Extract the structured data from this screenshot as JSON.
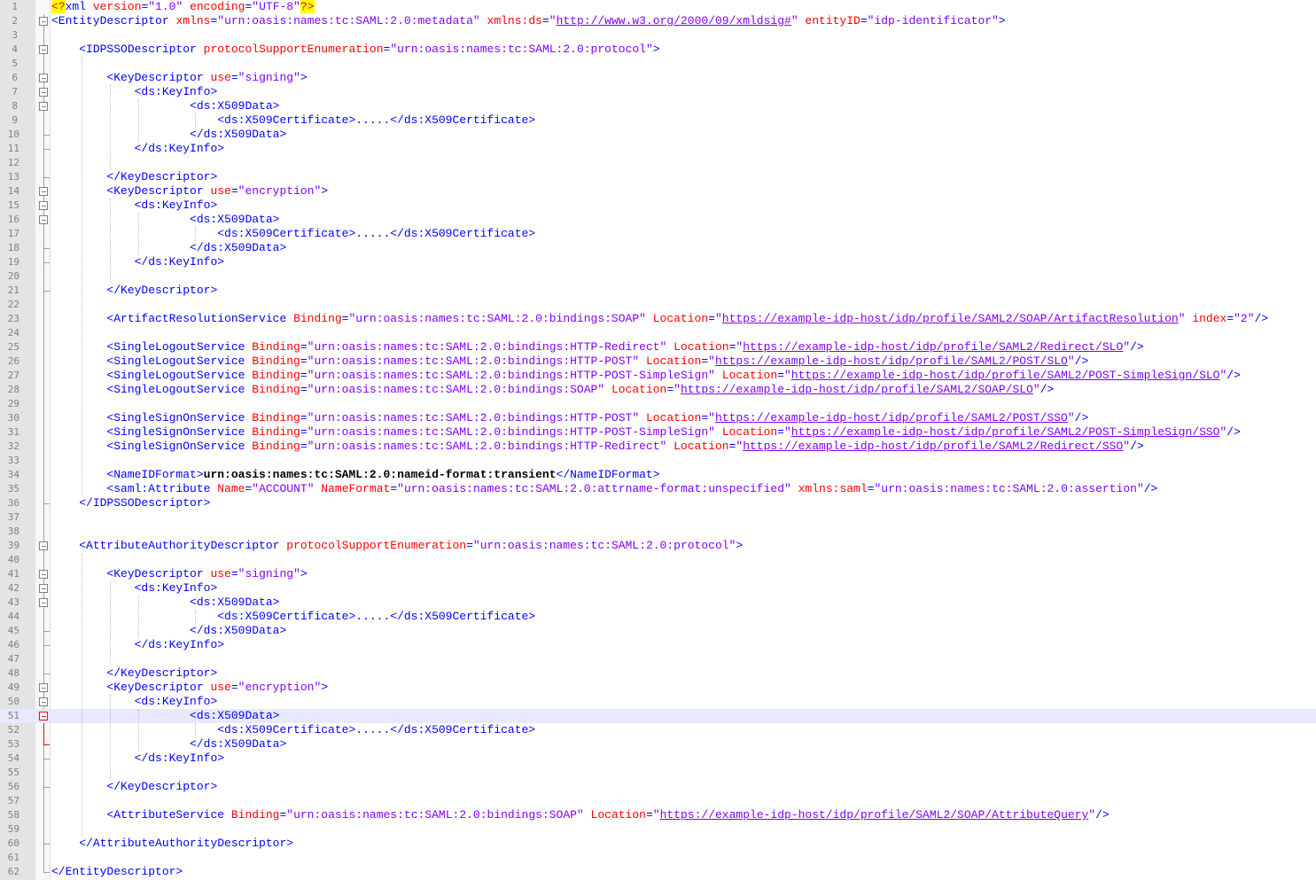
{
  "editor": {
    "current_line": 51,
    "lines": [
      {
        "n": "1",
        "i": 0,
        "tokens": [
          [
            "pi",
            "<?"
          ],
          [
            "t",
            "xml "
          ],
          [
            "a",
            "version"
          ],
          [
            "t",
            "="
          ],
          [
            "v",
            "\"1.0\""
          ],
          [
            "a",
            " encoding"
          ],
          [
            "t",
            "="
          ],
          [
            "v",
            "\"UTF-8\""
          ],
          [
            "pi",
            "?>"
          ]
        ]
      },
      {
        "n": "2",
        "i": 0,
        "tokens": [
          [
            "t",
            "<EntityDescriptor "
          ],
          [
            "a",
            "xmlns"
          ],
          [
            "t",
            "="
          ],
          [
            "v",
            "\"urn:oasis:names:tc:SAML:2.0:metadata\""
          ],
          [
            "a",
            " xmlns:ds"
          ],
          [
            "t",
            "="
          ],
          [
            "v",
            "\""
          ],
          [
            "u",
            "http://www.w3.org/2000/09/xmldsig#"
          ],
          [
            "v",
            "\""
          ],
          [
            "a",
            " entityID"
          ],
          [
            "t",
            "="
          ],
          [
            "v",
            "\"idp-identificator\""
          ],
          [
            "t",
            ">"
          ]
        ]
      },
      {
        "n": "3",
        "i": 0,
        "tokens": []
      },
      {
        "n": "4",
        "i": 4,
        "tokens": [
          [
            "t",
            "<IDPSSODescriptor "
          ],
          [
            "a",
            "protocolSupportEnumeration"
          ],
          [
            "t",
            "="
          ],
          [
            "v",
            "\"urn:oasis:names:tc:SAML:2.0:protocol\""
          ],
          [
            "t",
            ">"
          ]
        ]
      },
      {
        "n": "5",
        "i": 0,
        "tokens": []
      },
      {
        "n": "6",
        "i": 8,
        "tokens": [
          [
            "t",
            "<KeyDescriptor "
          ],
          [
            "a",
            "use"
          ],
          [
            "t",
            "="
          ],
          [
            "v",
            "\"signing\""
          ],
          [
            "t",
            ">"
          ]
        ]
      },
      {
        "n": "7",
        "i": 12,
        "tokens": [
          [
            "t",
            "<ds:KeyInfo>"
          ]
        ]
      },
      {
        "n": "8",
        "i": 20,
        "tokens": [
          [
            "t",
            "<ds:X509Data>"
          ]
        ]
      },
      {
        "n": "9",
        "i": 24,
        "tokens": [
          [
            "t",
            "<ds:X509Certificate>.....</ds:X509Certificate>"
          ]
        ]
      },
      {
        "n": "10",
        "i": 20,
        "tokens": [
          [
            "t",
            "</ds:X509Data>"
          ]
        ]
      },
      {
        "n": "11",
        "i": 12,
        "tokens": [
          [
            "t",
            "</ds:KeyInfo>"
          ]
        ]
      },
      {
        "n": "12",
        "i": 0,
        "tokens": []
      },
      {
        "n": "13",
        "i": 8,
        "tokens": [
          [
            "t",
            "</KeyDescriptor>"
          ]
        ]
      },
      {
        "n": "14",
        "i": 8,
        "tokens": [
          [
            "t",
            "<KeyDescriptor "
          ],
          [
            "a",
            "use"
          ],
          [
            "t",
            "="
          ],
          [
            "v",
            "\"encryption\""
          ],
          [
            "t",
            ">"
          ]
        ]
      },
      {
        "n": "15",
        "i": 12,
        "tokens": [
          [
            "t",
            "<ds:KeyInfo>"
          ]
        ]
      },
      {
        "n": "16",
        "i": 20,
        "tokens": [
          [
            "t",
            "<ds:X509Data>"
          ]
        ]
      },
      {
        "n": "17",
        "i": 24,
        "tokens": [
          [
            "t",
            "<ds:X509Certificate>.....</ds:X509Certificate>"
          ]
        ]
      },
      {
        "n": "18",
        "i": 20,
        "tokens": [
          [
            "t",
            "</ds:X509Data>"
          ]
        ]
      },
      {
        "n": "19",
        "i": 12,
        "tokens": [
          [
            "t",
            "</ds:KeyInfo>"
          ]
        ]
      },
      {
        "n": "20",
        "i": 0,
        "tokens": []
      },
      {
        "n": "21",
        "i": 8,
        "tokens": [
          [
            "t",
            "</KeyDescriptor>"
          ]
        ]
      },
      {
        "n": "22",
        "i": 0,
        "tokens": []
      },
      {
        "n": "23",
        "i": 8,
        "tokens": [
          [
            "t",
            "<ArtifactResolutionService "
          ],
          [
            "a",
            "Binding"
          ],
          [
            "t",
            "="
          ],
          [
            "v",
            "\"urn:oasis:names:tc:SAML:2.0:bindings:SOAP\""
          ],
          [
            "a",
            " Location"
          ],
          [
            "t",
            "="
          ],
          [
            "v",
            "\""
          ],
          [
            "u",
            "https://example-idp-host/idp/profile/SAML2/SOAP/ArtifactResolution"
          ],
          [
            "v",
            "\""
          ],
          [
            "a",
            " index"
          ],
          [
            "t",
            "="
          ],
          [
            "v",
            "\"2\""
          ],
          [
            "t",
            "/>"
          ]
        ]
      },
      {
        "n": "24",
        "i": 0,
        "tokens": []
      },
      {
        "n": "25",
        "i": 8,
        "tokens": [
          [
            "t",
            "<SingleLogoutService "
          ],
          [
            "a",
            "Binding"
          ],
          [
            "t",
            "="
          ],
          [
            "v",
            "\"urn:oasis:names:tc:SAML:2.0:bindings:HTTP-Redirect\""
          ],
          [
            "a",
            " Location"
          ],
          [
            "t",
            "="
          ],
          [
            "v",
            "\""
          ],
          [
            "u",
            "https://example-idp-host/idp/profile/SAML2/Redirect/SLO"
          ],
          [
            "v",
            "\""
          ],
          [
            "t",
            "/>"
          ]
        ]
      },
      {
        "n": "26",
        "i": 8,
        "tokens": [
          [
            "t",
            "<SingleLogoutService "
          ],
          [
            "a",
            "Binding"
          ],
          [
            "t",
            "="
          ],
          [
            "v",
            "\"urn:oasis:names:tc:SAML:2.0:bindings:HTTP-POST\""
          ],
          [
            "a",
            " Location"
          ],
          [
            "t",
            "="
          ],
          [
            "v",
            "\""
          ],
          [
            "u",
            "https://example-idp-host/idp/profile/SAML2/POST/SLO"
          ],
          [
            "v",
            "\""
          ],
          [
            "t",
            "/>"
          ]
        ]
      },
      {
        "n": "27",
        "i": 8,
        "tokens": [
          [
            "t",
            "<SingleLogoutService "
          ],
          [
            "a",
            "Binding"
          ],
          [
            "t",
            "="
          ],
          [
            "v",
            "\"urn:oasis:names:tc:SAML:2.0:bindings:HTTP-POST-SimpleSign\""
          ],
          [
            "a",
            " Location"
          ],
          [
            "t",
            "="
          ],
          [
            "v",
            "\""
          ],
          [
            "u",
            "https://example-idp-host/idp/profile/SAML2/POST-SimpleSign/SLO"
          ],
          [
            "v",
            "\""
          ],
          [
            "t",
            "/>"
          ]
        ]
      },
      {
        "n": "28",
        "i": 8,
        "tokens": [
          [
            "t",
            "<SingleLogoutService "
          ],
          [
            "a",
            "Binding"
          ],
          [
            "t",
            "="
          ],
          [
            "v",
            "\"urn:oasis:names:tc:SAML:2.0:bindings:SOAP\""
          ],
          [
            "a",
            " Location"
          ],
          [
            "t",
            "="
          ],
          [
            "v",
            "\""
          ],
          [
            "u",
            "https://example-idp-host/idp/profile/SAML2/SOAP/SLO"
          ],
          [
            "v",
            "\""
          ],
          [
            "t",
            "/>"
          ]
        ]
      },
      {
        "n": "29",
        "i": 0,
        "tokens": []
      },
      {
        "n": "30",
        "i": 8,
        "tokens": [
          [
            "t",
            "<SingleSignOnService "
          ],
          [
            "a",
            "Binding"
          ],
          [
            "t",
            "="
          ],
          [
            "v",
            "\"urn:oasis:names:tc:SAML:2.0:bindings:HTTP-POST\""
          ],
          [
            "a",
            " Location"
          ],
          [
            "t",
            "="
          ],
          [
            "v",
            "\""
          ],
          [
            "u",
            "https://example-idp-host/idp/profile/SAML2/POST/SSO"
          ],
          [
            "v",
            "\""
          ],
          [
            "t",
            "/>"
          ]
        ]
      },
      {
        "n": "31",
        "i": 8,
        "tokens": [
          [
            "t",
            "<SingleSignOnService "
          ],
          [
            "a",
            "Binding"
          ],
          [
            "t",
            "="
          ],
          [
            "v",
            "\"urn:oasis:names:tc:SAML:2.0:bindings:HTTP-POST-SimpleSign\""
          ],
          [
            "a",
            " Location"
          ],
          [
            "t",
            "="
          ],
          [
            "v",
            "\""
          ],
          [
            "u",
            "https://example-idp-host/idp/profile/SAML2/POST-SimpleSign/SSO"
          ],
          [
            "v",
            "\""
          ],
          [
            "t",
            "/>"
          ]
        ]
      },
      {
        "n": "32",
        "i": 8,
        "tokens": [
          [
            "t",
            "<SingleSignOnService "
          ],
          [
            "a",
            "Binding"
          ],
          [
            "t",
            "="
          ],
          [
            "v",
            "\"urn:oasis:names:tc:SAML:2.0:bindings:HTTP-Redirect\""
          ],
          [
            "a",
            " Location"
          ],
          [
            "t",
            "="
          ],
          [
            "v",
            "\""
          ],
          [
            "u",
            "https://example-idp-host/idp/profile/SAML2/Redirect/SSO"
          ],
          [
            "v",
            "\""
          ],
          [
            "t",
            "/>"
          ]
        ]
      },
      {
        "n": "33",
        "i": 0,
        "tokens": []
      },
      {
        "n": "34",
        "i": 8,
        "tokens": [
          [
            "t",
            "<NameIDFormat>"
          ],
          [
            "x",
            "urn:oasis:names:tc:SAML:2.0:nameid-format:transient"
          ],
          [
            "t",
            "</NameIDFormat>"
          ]
        ]
      },
      {
        "n": "35",
        "i": 8,
        "tokens": [
          [
            "t",
            "<saml:Attribute "
          ],
          [
            "a",
            "Name"
          ],
          [
            "t",
            "="
          ],
          [
            "v",
            "\"ACCOUNT\""
          ],
          [
            "a",
            " NameFormat"
          ],
          [
            "t",
            "="
          ],
          [
            "v",
            "\"urn:oasis:names:tc:SAML:2.0:attrname-format:unspecified\""
          ],
          [
            "a",
            " xmlns:saml"
          ],
          [
            "t",
            "="
          ],
          [
            "v",
            "\"urn:oasis:names:tc:SAML:2.0:assertion\""
          ],
          [
            "t",
            "/>"
          ]
        ]
      },
      {
        "n": "36",
        "i": 4,
        "tokens": [
          [
            "t",
            "</IDPSSODescriptor>"
          ]
        ]
      },
      {
        "n": "37",
        "i": 0,
        "tokens": []
      },
      {
        "n": "38",
        "i": 0,
        "tokens": []
      },
      {
        "n": "39",
        "i": 4,
        "tokens": [
          [
            "t",
            "<AttributeAuthorityDescriptor "
          ],
          [
            "a",
            "protocolSupportEnumeration"
          ],
          [
            "t",
            "="
          ],
          [
            "v",
            "\"urn:oasis:names:tc:SAML:2.0:protocol\""
          ],
          [
            "t",
            ">"
          ]
        ]
      },
      {
        "n": "40",
        "i": 0,
        "tokens": []
      },
      {
        "n": "41",
        "i": 8,
        "tokens": [
          [
            "t",
            "<KeyDescriptor "
          ],
          [
            "a",
            "use"
          ],
          [
            "t",
            "="
          ],
          [
            "v",
            "\"signing\""
          ],
          [
            "t",
            ">"
          ]
        ]
      },
      {
        "n": "42",
        "i": 12,
        "tokens": [
          [
            "t",
            "<ds:KeyInfo>"
          ]
        ]
      },
      {
        "n": "43",
        "i": 20,
        "tokens": [
          [
            "t",
            "<ds:X509Data>"
          ]
        ]
      },
      {
        "n": "44",
        "i": 24,
        "tokens": [
          [
            "t",
            "<ds:X509Certificate>.....</ds:X509Certificate>"
          ]
        ]
      },
      {
        "n": "45",
        "i": 20,
        "tokens": [
          [
            "t",
            "</ds:X509Data>"
          ]
        ]
      },
      {
        "n": "46",
        "i": 12,
        "tokens": [
          [
            "t",
            "</ds:KeyInfo>"
          ]
        ]
      },
      {
        "n": "47",
        "i": 0,
        "tokens": []
      },
      {
        "n": "48",
        "i": 8,
        "tokens": [
          [
            "t",
            "</KeyDescriptor>"
          ]
        ]
      },
      {
        "n": "49",
        "i": 8,
        "tokens": [
          [
            "t",
            "<KeyDescriptor "
          ],
          [
            "a",
            "use"
          ],
          [
            "t",
            "="
          ],
          [
            "v",
            "\"encryption\""
          ],
          [
            "t",
            ">"
          ]
        ]
      },
      {
        "n": "50",
        "i": 12,
        "tokens": [
          [
            "t",
            "<ds:KeyInfo>"
          ]
        ]
      },
      {
        "n": "51",
        "i": 20,
        "tokens": [
          [
            "t",
            "<ds:X509Data>"
          ]
        ]
      },
      {
        "n": "52",
        "i": 24,
        "tokens": [
          [
            "t",
            "<ds:X509Certificate>.....</ds:X509Certificate>"
          ]
        ]
      },
      {
        "n": "53",
        "i": 20,
        "tokens": [
          [
            "t",
            "</ds:X509Data>"
          ]
        ]
      },
      {
        "n": "54",
        "i": 12,
        "tokens": [
          [
            "t",
            "</ds:KeyInfo>"
          ]
        ]
      },
      {
        "n": "55",
        "i": 0,
        "tokens": []
      },
      {
        "n": "56",
        "i": 8,
        "tokens": [
          [
            "t",
            "</KeyDescriptor>"
          ]
        ]
      },
      {
        "n": "57",
        "i": 0,
        "tokens": []
      },
      {
        "n": "58",
        "i": 8,
        "tokens": [
          [
            "t",
            "<AttributeService "
          ],
          [
            "a",
            "Binding"
          ],
          [
            "t",
            "="
          ],
          [
            "v",
            "\"urn:oasis:names:tc:SAML:2.0:bindings:SOAP\""
          ],
          [
            "a",
            " Location"
          ],
          [
            "t",
            "="
          ],
          [
            "v",
            "\""
          ],
          [
            "u",
            "https://example-idp-host/idp/profile/SAML2/SOAP/AttributeQuery"
          ],
          [
            "v",
            "\""
          ],
          [
            "t",
            "/>"
          ]
        ]
      },
      {
        "n": "59",
        "i": 0,
        "tokens": []
      },
      {
        "n": "60",
        "i": 4,
        "tokens": [
          [
            "t",
            "</AttributeAuthorityDescriptor>"
          ]
        ]
      },
      {
        "n": "61",
        "i": 0,
        "tokens": []
      },
      {
        "n": "62",
        "i": 0,
        "tokens": [
          [
            "t",
            "</EntityDescriptor>"
          ]
        ]
      }
    ]
  }
}
